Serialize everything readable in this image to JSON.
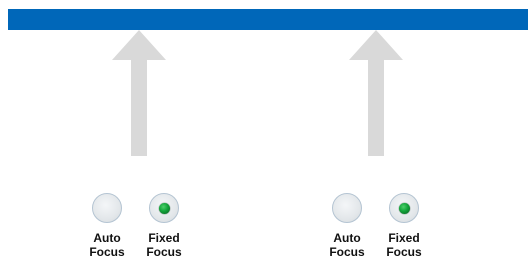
{
  "colors": {
    "bar": "#0067B9",
    "arrow": "#D9D9D9",
    "led_on": "#12A33A"
  },
  "panels": [
    {
      "auto_focus": {
        "line1": "Auto",
        "line2": "Focus",
        "lit": false
      },
      "fixed_focus": {
        "line1": "Fixed",
        "line2": "Focus",
        "lit": true
      }
    },
    {
      "auto_focus": {
        "line1": "Auto",
        "line2": "Focus",
        "lit": false
      },
      "fixed_focus": {
        "line1": "Fixed",
        "line2": "Focus",
        "lit": true
      }
    }
  ]
}
